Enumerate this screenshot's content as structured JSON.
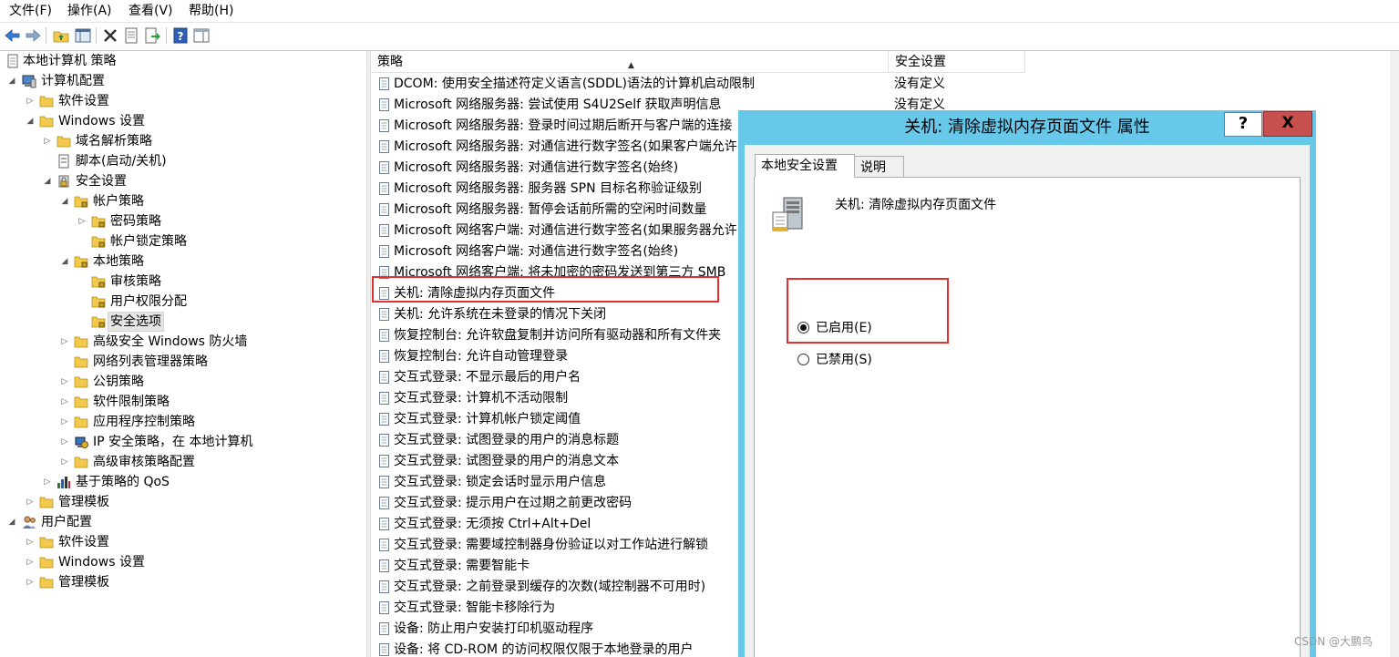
{
  "menubar": {
    "file": "文件(F)",
    "action": "操作(A)",
    "view": "查看(V)",
    "help": "帮助(H)"
  },
  "toolbar": {
    "icons": [
      "back-icon",
      "forward-icon",
      "up-folder-icon",
      "show-tree-icon",
      "delete-icon",
      "properties-icon",
      "export-icon",
      "help-icon",
      "show-hide-icon"
    ]
  },
  "tree": {
    "nodes": [
      {
        "label": "本地计算机 策略"
      },
      {
        "label": "计算机配置"
      },
      {
        "label": "软件设置"
      },
      {
        "label": "Windows 设置"
      },
      {
        "label": "域名解析策略"
      },
      {
        "label": "脚本(启动/关机)"
      },
      {
        "label": "安全设置"
      },
      {
        "label": "帐户策略"
      },
      {
        "label": "密码策略"
      },
      {
        "label": "帐户锁定策略"
      },
      {
        "label": "本地策略"
      },
      {
        "label": "审核策略"
      },
      {
        "label": "用户权限分配"
      },
      {
        "label": "安全选项"
      },
      {
        "label": "高级安全 Windows 防火墙"
      },
      {
        "label": "网络列表管理器策略"
      },
      {
        "label": "公钥策略"
      },
      {
        "label": "软件限制策略"
      },
      {
        "label": "应用程序控制策略"
      },
      {
        "label": "IP 安全策略，在 本地计算机"
      },
      {
        "label": "高级审核策略配置"
      },
      {
        "label": "基于策略的 QoS"
      },
      {
        "label": "管理模板"
      },
      {
        "label": "用户配置"
      },
      {
        "label": "软件设置"
      },
      {
        "label": "Windows 设置"
      },
      {
        "label": "管理模板"
      }
    ]
  },
  "list": {
    "columns": {
      "policy": "策略",
      "setting": "安全设置"
    },
    "rows": [
      {
        "name": "DCOM: 使用安全描述符定义语言(SDDL)语法的计算机启动限制",
        "setting": "没有定义"
      },
      {
        "name": "Microsoft 网络服务器: 尝试使用 S4U2Self 获取声明信息",
        "setting": "没有定义"
      },
      {
        "name": "Microsoft 网络服务器: 登录时间过期后断开与客户端的连接",
        "setting": ""
      },
      {
        "name": "Microsoft 网络服务器: 对通信进行数字签名(如果客户端允许)",
        "setting": ""
      },
      {
        "name": "Microsoft 网络服务器: 对通信进行数字签名(始终)",
        "setting": ""
      },
      {
        "name": "Microsoft 网络服务器: 服务器 SPN 目标名称验证级别",
        "setting": ""
      },
      {
        "name": "Microsoft 网络服务器: 暂停会话前所需的空闲时间数量",
        "setting": ""
      },
      {
        "name": "Microsoft 网络客户端: 对通信进行数字签名(如果服务器允许)",
        "setting": ""
      },
      {
        "name": "Microsoft 网络客户端: 对通信进行数字签名(始终)",
        "setting": ""
      },
      {
        "name": "Microsoft 网络客户端: 将未加密的密码发送到第三方 SMB",
        "setting": ""
      },
      {
        "name": "关机: 清除虚拟内存页面文件",
        "setting": ""
      },
      {
        "name": "关机: 允许系统在未登录的情况下关闭",
        "setting": ""
      },
      {
        "name": "恢复控制台: 允许软盘复制并访问所有驱动器和所有文件夹",
        "setting": ""
      },
      {
        "name": "恢复控制台: 允许自动管理登录",
        "setting": ""
      },
      {
        "name": "交互式登录: 不显示最后的用户名",
        "setting": ""
      },
      {
        "name": "交互式登录: 计算机不活动限制",
        "setting": ""
      },
      {
        "name": "交互式登录: 计算机帐户锁定阈值",
        "setting": ""
      },
      {
        "name": "交互式登录: 试图登录的用户的消息标题",
        "setting": ""
      },
      {
        "name": "交互式登录: 试图登录的用户的消息文本",
        "setting": ""
      },
      {
        "name": "交互式登录: 锁定会话时显示用户信息",
        "setting": ""
      },
      {
        "name": "交互式登录: 提示用户在过期之前更改密码",
        "setting": ""
      },
      {
        "name": "交互式登录: 无须按 Ctrl+Alt+Del",
        "setting": ""
      },
      {
        "name": "交互式登录: 需要域控制器身份验证以对工作站进行解锁",
        "setting": ""
      },
      {
        "name": "交互式登录: 需要智能卡",
        "setting": ""
      },
      {
        "name": "交互式登录: 之前登录到缓存的次数(域控制器不可用时)",
        "setting": ""
      },
      {
        "name": "交互式登录: 智能卡移除行为",
        "setting": ""
      },
      {
        "name": "设备: 防止用户安装打印机驱动程序",
        "setting": ""
      },
      {
        "name": "设备: 将 CD-ROM 的访问权限仅限于本地登录的用户",
        "setting": ""
      }
    ]
  },
  "dialog": {
    "title": "关机: 清除虚拟内存页面文件 属性",
    "help_label": "?",
    "close_label": "X",
    "tabs": [
      {
        "label": "本地安全设置"
      },
      {
        "label": "说明"
      }
    ],
    "policy_name": "关机: 清除虚拟内存页面文件",
    "options": [
      {
        "label": "已启用(E)",
        "selected": true
      },
      {
        "label": "已禁用(S)",
        "selected": false
      }
    ]
  },
  "watermark": "CSDN @大鹏鸟",
  "colors": {
    "title_bar": "#68c8ea",
    "close_button": "#c7504e",
    "highlight": "#e33131",
    "folder": "#f2c94c"
  }
}
